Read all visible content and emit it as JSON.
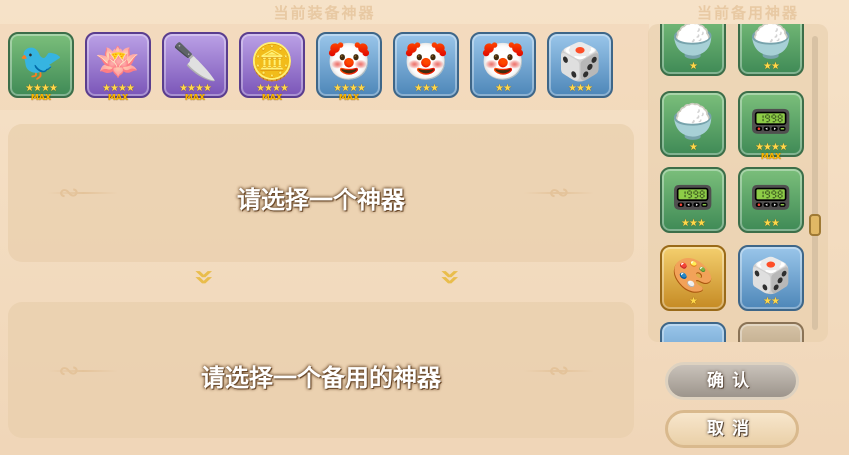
{
  "equipped": {
    "title": "当前装备神器",
    "slots": [
      {
        "glyph": "🐦",
        "color": "green",
        "stars": "★★★★",
        "max": "MAX"
      },
      {
        "glyph": "🪷",
        "color": "purple",
        "stars": "★★★★",
        "max": "MAX"
      },
      {
        "glyph": "🔪",
        "color": "purple",
        "stars": "★★★★",
        "max": "MAX"
      },
      {
        "glyph": "🪙",
        "color": "purple",
        "stars": "★★★★",
        "max": "MAX"
      },
      {
        "glyph": "🤡",
        "color": "blue",
        "stars": "★★★★",
        "max": "MAX"
      },
      {
        "glyph": "🤡",
        "color": "blue",
        "stars": "★★★",
        "max": ""
      },
      {
        "glyph": "🤡",
        "color": "blue",
        "stars": "★★",
        "max": ""
      },
      {
        "glyph": "🎲",
        "color": "blue",
        "stars": "★★★",
        "max": ""
      }
    ]
  },
  "prompts": {
    "select_artifact": "请选择一个神器",
    "select_backup_artifact": "请选择一个备用的神器"
  },
  "backup": {
    "title": "当前备用神器",
    "slots": [
      {
        "glyph": "🍚",
        "color": "green",
        "stars": "★"
      },
      {
        "glyph": "🍚",
        "color": "green",
        "stars": "★★"
      },
      {
        "glyph": "🍚",
        "color": "green",
        "stars": "★"
      },
      {
        "glyph": "📟",
        "color": "green",
        "stars": "★★★★",
        "max": "MAX"
      },
      {
        "glyph": "📟",
        "color": "green",
        "stars": "★★★"
      },
      {
        "glyph": "📟",
        "color": "green",
        "stars": "★★"
      },
      {
        "glyph": "🎨",
        "color": "gold",
        "stars": "★"
      },
      {
        "glyph": "🎲",
        "color": "blue",
        "stars": "★★"
      },
      {
        "glyph": "⚪",
        "color": "blue",
        "stars": ""
      },
      {
        "glyph": "",
        "color": "gray",
        "stars": ""
      }
    ]
  },
  "buttons": {
    "confirm": "确认",
    "cancel": "取消"
  },
  "icons": {
    "flourish": "ornament-flourish-icon",
    "chevron": "double-chevron-down-icon"
  }
}
